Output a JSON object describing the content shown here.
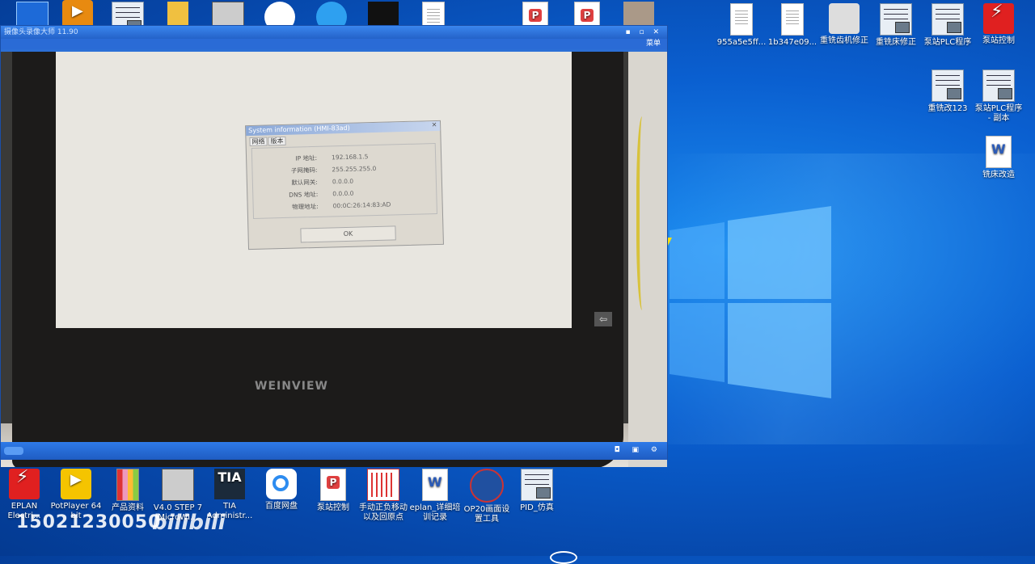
{
  "desktop": {
    "right_icons": [
      {
        "label": "955a5e5ff...",
        "icon": "document-icon"
      },
      {
        "label": "1b347e09...",
        "icon": "document-icon"
      },
      {
        "label": "重铣齿机修正",
        "icon": "tool-icon"
      },
      {
        "label": "重铣床修正",
        "icon": "ladder-logic-icon"
      },
      {
        "label": "泵站PLC程序",
        "icon": "ladder-logic-icon"
      },
      {
        "label": "泵站控制",
        "icon": "eplan-icon"
      },
      {
        "label": "重铣改123",
        "icon": "ladder-logic-icon"
      },
      {
        "label": "泵站PLC程序 - 副本",
        "icon": "ladder-logic-icon"
      },
      {
        "label": "铣床改造",
        "icon": "word-icon"
      }
    ],
    "bottom_icons": [
      {
        "label": "EPLAN Electri...",
        "icon": "eplan-icon"
      },
      {
        "label": "PotPlayer 64 bit",
        "icon": "potplayer-icon"
      },
      {
        "label": "产品资料",
        "icon": "books-icon"
      },
      {
        "label": "V4.0 STEP 7 MicroWI...",
        "icon": "step7-icon"
      },
      {
        "label": "TIA Administr...",
        "icon": "tia-icon"
      },
      {
        "label": "百度网盘",
        "icon": "baidu-netdisk-icon"
      },
      {
        "label": "泵站控制",
        "icon": "pdf-icon"
      },
      {
        "label": "手动正负移动以及回原点",
        "icon": "plc-program-icon"
      },
      {
        "label": "eplan_详细培训记录",
        "icon": "word-icon"
      },
      {
        "label": "OP20画面设置工具",
        "icon": "globe-icon"
      },
      {
        "label": "PID_仿真",
        "icon": "ladder-logic-icon"
      }
    ]
  },
  "player_window": {
    "title": "摄像头录像大师 11.90",
    "menu_label": "菜单",
    "brand_on_device": "WEINVIEW"
  },
  "hmi_dialog": {
    "title": "System information (HMI-83ad)",
    "tabs": [
      "网络",
      "版本"
    ],
    "fields": [
      {
        "label": "IP 地址:",
        "value": "192.168.1.5"
      },
      {
        "label": "子网掩码:",
        "value": "255.255.255.0"
      },
      {
        "label": "默认网关:",
        "value": "0.0.0.0"
      },
      {
        "label": "DNS 地址:",
        "value": "0.0.0.0"
      },
      {
        "label": "物理地址:",
        "value": "00:0C:26:14:83:AD"
      }
    ],
    "ok_label": "OK"
  },
  "watermark": {
    "phone": "15021230050",
    "site": "bilibili"
  }
}
